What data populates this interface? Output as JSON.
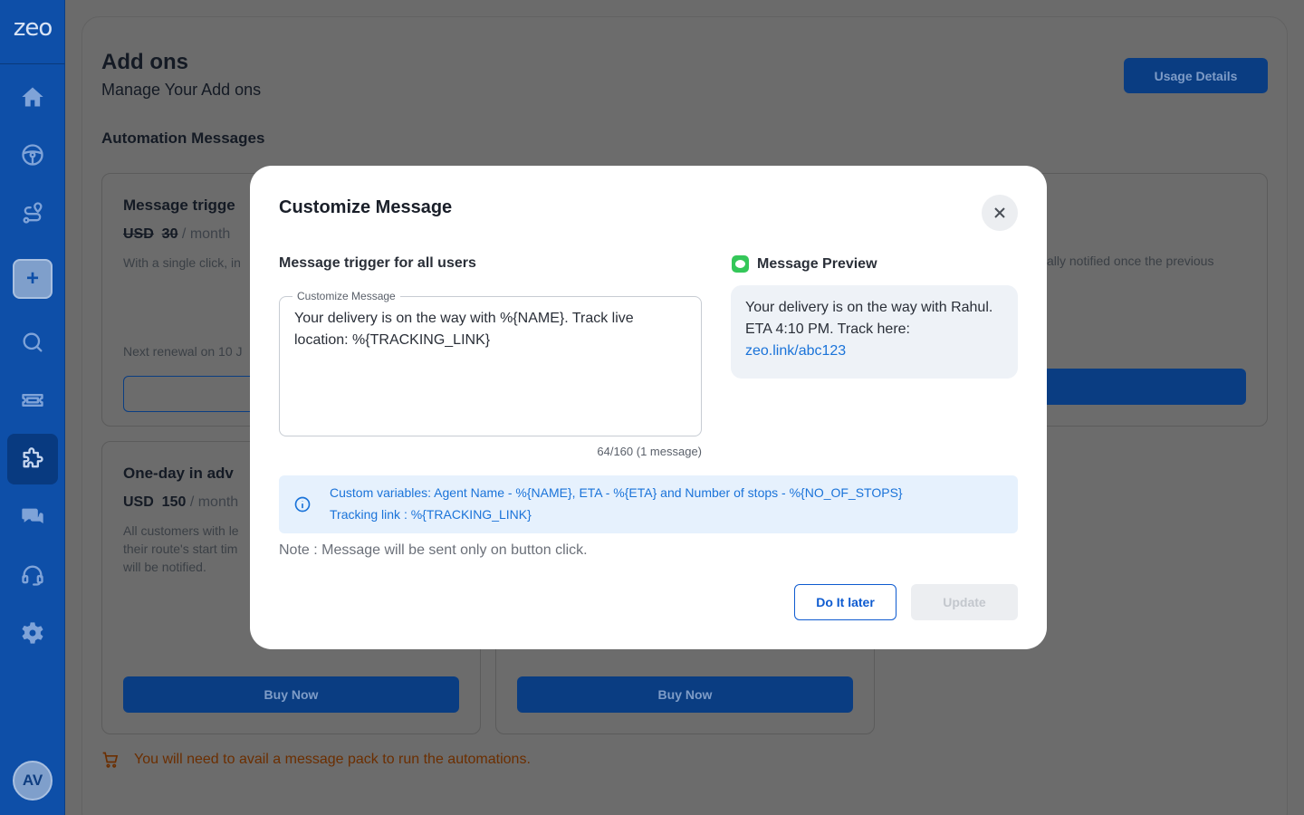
{
  "brand": {
    "logo": "zeo",
    "accent": "#0e4fa8",
    "primary_button": "#0e5bd0"
  },
  "sidebar": {
    "items": [
      {
        "name": "home",
        "icon": "home-icon"
      },
      {
        "name": "drive",
        "icon": "steering-wheel-icon"
      },
      {
        "name": "routes",
        "icon": "route-icon"
      },
      {
        "name": "add",
        "label": "+"
      },
      {
        "name": "search",
        "icon": "search-icon"
      },
      {
        "name": "tickets",
        "icon": "ticket-icon"
      },
      {
        "name": "addons",
        "icon": "puzzle-icon",
        "active": true
      },
      {
        "name": "chat",
        "icon": "chat-icon"
      },
      {
        "name": "support",
        "icon": "headset-icon"
      },
      {
        "name": "settings",
        "icon": "gear-icon"
      }
    ],
    "avatar": "AV"
  },
  "page": {
    "title": "Add ons",
    "subtitle": "Manage Your Add ons",
    "usage_button": "Usage Details",
    "section_title": "Automation Messages",
    "cards": [
      {
        "title": "Message trigge",
        "currency": "USD",
        "price": "30",
        "period": "/ month",
        "desc": "With a single click, in",
        "renewal": "Next renewal on 10 J"
      },
      {
        "title": "One-day in adv",
        "currency": "USD",
        "price": "150",
        "period": "/ month",
        "desc1": "All customers with le",
        "desc2": "their route's start tim",
        "desc3": "will be notified.",
        "button": "Buy Now"
      },
      {
        "button": "Buy Now"
      },
      {
        "desc": "ally notified once the previous"
      }
    ],
    "warning": "You will need to avail a message pack to run the automations."
  },
  "modal": {
    "title": "Customize Message",
    "trigger_label": "Message trigger for all users",
    "field_legend": "Customize Message",
    "message": "Your delivery is on the way with %{NAME}. Track live location: %{TRACKING_LINK}",
    "char_count": "64/160 (1 message)",
    "preview_label": "Message Preview",
    "preview_text": "Your delivery is on the way with Rahul. ETA 4:10 PM. Track here:",
    "preview_link": "zeo.link/abc123",
    "info_line1": "Custom variables: Agent Name - %{NAME}, ETA - %{ETA} and Number of stops - %{NO_OF_STOPS}",
    "info_line2": "Tracking link : %{TRACKING_LINK}",
    "note": "Note : Message will be sent only on button click.",
    "later_button": "Do It later",
    "update_button": "Update"
  }
}
